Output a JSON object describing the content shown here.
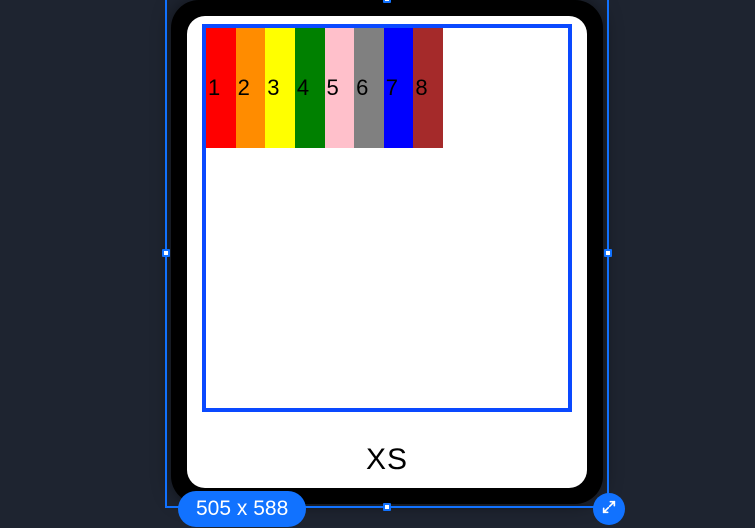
{
  "columns": [
    {
      "label": "1",
      "color": "#ff0000"
    },
    {
      "label": "2",
      "color": "#ff8c00"
    },
    {
      "label": "3",
      "color": "#ffff00"
    },
    {
      "label": "4",
      "color": "#008000"
    },
    {
      "label": "5",
      "color": "#ffc0cb"
    },
    {
      "label": "6",
      "color": "#808080"
    },
    {
      "label": "7",
      "color": "#0000ff"
    },
    {
      "label": "8",
      "color": "#a52a2a"
    }
  ],
  "breakpoint_label": "XS",
  "canvas_border_color": "#0a49ff",
  "selection": {
    "size_label": "505 x 588",
    "accent": "#1172ff"
  }
}
